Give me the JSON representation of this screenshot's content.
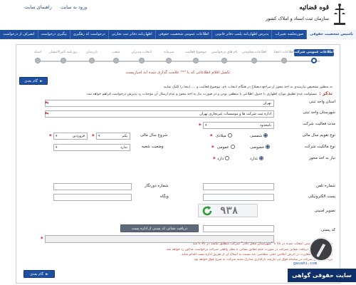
{
  "header": {
    "links": [
      "ورود به سایت",
      "راهنمای سایت"
    ],
    "logo_title": "قوه قضائیه",
    "logo_subtitle": "سازمان ثبت اسناد و املاک کشور"
  },
  "nav": {
    "items": [
      "تاسیس شخصیت حقوقی",
      "صورتجلسه تغییرات",
      "پذیرش اظهارنامه پلمپ دفاتر قانونی",
      "اطلاعات عمومی شخصیت حقوقی",
      "اظهارنامه دفاتر ثبت تجارتی",
      "درخواست کد رهگیری",
      "پیگیری درخواست",
      "انصراف از درخواست"
    ]
  },
  "stepper": {
    "steps": [
      "اطلاعات عمومی شرکت",
      "اطلاعات اعضا",
      "اطلاعات مقاومتی",
      "نام های درخواستی",
      "موضوع فعالیت",
      "سرمایه",
      "انتخاب مدیران",
      "شعب",
      "بازرسان",
      "روزنامه کثیرالانتشار",
      "اسناد"
    ],
    "active_index": 0
  },
  "required_note": "تکمیل اقلام اطلاعاتی که با \"*\" علامت گذاری شده اند اجباریست",
  "buttons": {
    "next_top": "گام بعدی",
    "next_bottom": "گام بعدی",
    "postal_inquiry": "دریافت نشانی کد پستی از اداره پست"
  },
  "notices": {
    "line1": "به منظور تشخیص نیازمندی به اخذ مجوز از مراجع ذیصلاح در هنگام انتخاب نام، موضوع فعالیت و .... اینجا را کلیک نمایید",
    "tazakor": "تذکر :",
    "line2": "مسئولیت عدم تطبیق موارد اظهاری با جدول اطلاعی یا منطقی بودن و در صورت نیاز به اخذ مجوز و عدم ارسال آن موجبات رد پذیرش درخواست فراهم خواهد شد."
  },
  "form": {
    "province": {
      "label": "استان واحد ثبتی",
      "value": "تهران"
    },
    "registry_unit": {
      "label": "شهرستان واحد ثبتی",
      "value": "اداره ثبت شرکت ها و موسسات غیرتجاری تهران"
    },
    "company_duration": {
      "label": "مدت فعالیت شرکت",
      "value": "نامحدود"
    },
    "calendar_type": {
      "label": "نوع تقویم سال مالی",
      "options": [
        "شمسی",
        "میلادی"
      ],
      "selected": 0
    },
    "fiscal_start": {
      "label": "شروع سال مالی",
      "day": "یکم",
      "month": "فروردین"
    },
    "ownership_type": {
      "label": "نوع مالکیت شرکت",
      "options": [
        "خصوصی",
        "عمومی"
      ],
      "selected": 0
    },
    "branch_status": {
      "label": "وضعیت شعبه",
      "value": "ندارد"
    },
    "license_required": {
      "label": "نیاز به اخذ مجوز",
      "options": [
        "ندارد",
        "دارد"
      ],
      "selected": 0
    },
    "phone": {
      "label": "شماره تلفن"
    },
    "fax": {
      "label": "شماره دورنگار"
    },
    "email": {
      "label": "پست الکترونیکی"
    },
    "website": {
      "label": "وبگاه"
    },
    "security_image": {
      "label": "تصویر امنیتی",
      "captcha_text": "۹۳۸"
    },
    "postal_code": {
      "label": "کد پستی"
    },
    "postal_hint": "شهرستان واحد ثبتی انتخاب شده در بالا با \"شهرستان محل دفتر\" شرکت منطبق نباشد در بالا با شد .",
    "warnings": [
      "لازم به ذکر است دریافت نشانی شرکت در صورت عدم تطابق نشانی با محل واقعی شرکت درخواست مذکور رد خواهد شد.",
      "در صورت وجود مغایرت در آدرس اعلامی دفتر، متقاضی باید نسبت به اصلاح آن از طریق اداره پست اقدام نماید.",
      "دریافت نشانی شرکت در سامانه فوق نیز نیازمند بارگذاری مدارک مثبته شرکت به شرح فوق خواهد بود."
    ]
  },
  "watermark": {
    "site": "gavahi.com",
    "brand": "سایت حقوقی گواهی"
  },
  "colors": {
    "nav_blue": "#1f4fa0",
    "required_red": "#d00000",
    "brand_navy": "#0f2f6a"
  }
}
